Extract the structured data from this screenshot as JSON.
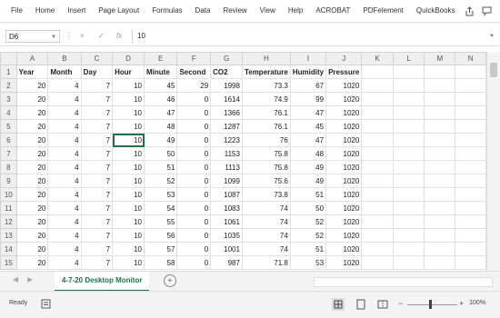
{
  "ribbon": {
    "tabs": [
      "File",
      "Home",
      "Insert",
      "Page Layout",
      "Formulas",
      "Data",
      "Review",
      "View",
      "Help",
      "ACROBAT",
      "PDFelement",
      "QuickBooks"
    ]
  },
  "formula_bar": {
    "name_box": "D6",
    "cancel_symbol": "×",
    "enter_symbol": "✓",
    "fx_symbol": "fx",
    "value": "10"
  },
  "grid": {
    "column_letters": [
      "A",
      "B",
      "C",
      "D",
      "E",
      "F",
      "G",
      "H",
      "I",
      "J",
      "K",
      "L",
      "M",
      "N"
    ],
    "headers": [
      "Year",
      "Month",
      "Day",
      "Hour",
      "Minute",
      "Second",
      "CO2",
      "Temperature",
      "Humidity",
      "Pressure"
    ],
    "rows": [
      [
        "20",
        "4",
        "7",
        "10",
        "45",
        "29",
        "1998",
        "73.3",
        "67",
        "1020"
      ],
      [
        "20",
        "4",
        "7",
        "10",
        "46",
        "0",
        "1614",
        "74.9",
        "99",
        "1020"
      ],
      [
        "20",
        "4",
        "7",
        "10",
        "47",
        "0",
        "1366",
        "76.1",
        "47",
        "1020"
      ],
      [
        "20",
        "4",
        "7",
        "10",
        "48",
        "0",
        "1287",
        "76.1",
        "45",
        "1020"
      ],
      [
        "20",
        "4",
        "7",
        "10",
        "49",
        "0",
        "1223",
        "76",
        "47",
        "1020"
      ],
      [
        "20",
        "4",
        "7",
        "10",
        "50",
        "0",
        "1153",
        "75.8",
        "48",
        "1020"
      ],
      [
        "20",
        "4",
        "7",
        "10",
        "51",
        "0",
        "1113",
        "75.8",
        "49",
        "1020"
      ],
      [
        "20",
        "4",
        "7",
        "10",
        "52",
        "0",
        "1099",
        "75.6",
        "49",
        "1020"
      ],
      [
        "20",
        "4",
        "7",
        "10",
        "53",
        "0",
        "1087",
        "73.8",
        "51",
        "1020"
      ],
      [
        "20",
        "4",
        "7",
        "10",
        "54",
        "0",
        "1083",
        "74",
        "50",
        "1020"
      ],
      [
        "20",
        "4",
        "7",
        "10",
        "55",
        "0",
        "1061",
        "74",
        "52",
        "1020"
      ],
      [
        "20",
        "4",
        "7",
        "10",
        "56",
        "0",
        "1035",
        "74",
        "52",
        "1020"
      ],
      [
        "20",
        "4",
        "7",
        "10",
        "57",
        "0",
        "1001",
        "74",
        "51",
        "1020"
      ],
      [
        "20",
        "4",
        "7",
        "10",
        "58",
        "0",
        "987",
        "71.8",
        "53",
        "1020"
      ]
    ]
  },
  "sheet_tabs": {
    "active": "4-7-20 Desktop Monitor",
    "add_symbol": "+"
  },
  "status_bar": {
    "ready": "Ready",
    "zoom": "100%"
  },
  "colors": {
    "accent": "#217346",
    "header_bg": "#efefef",
    "gridline": "#e2e2e2"
  }
}
